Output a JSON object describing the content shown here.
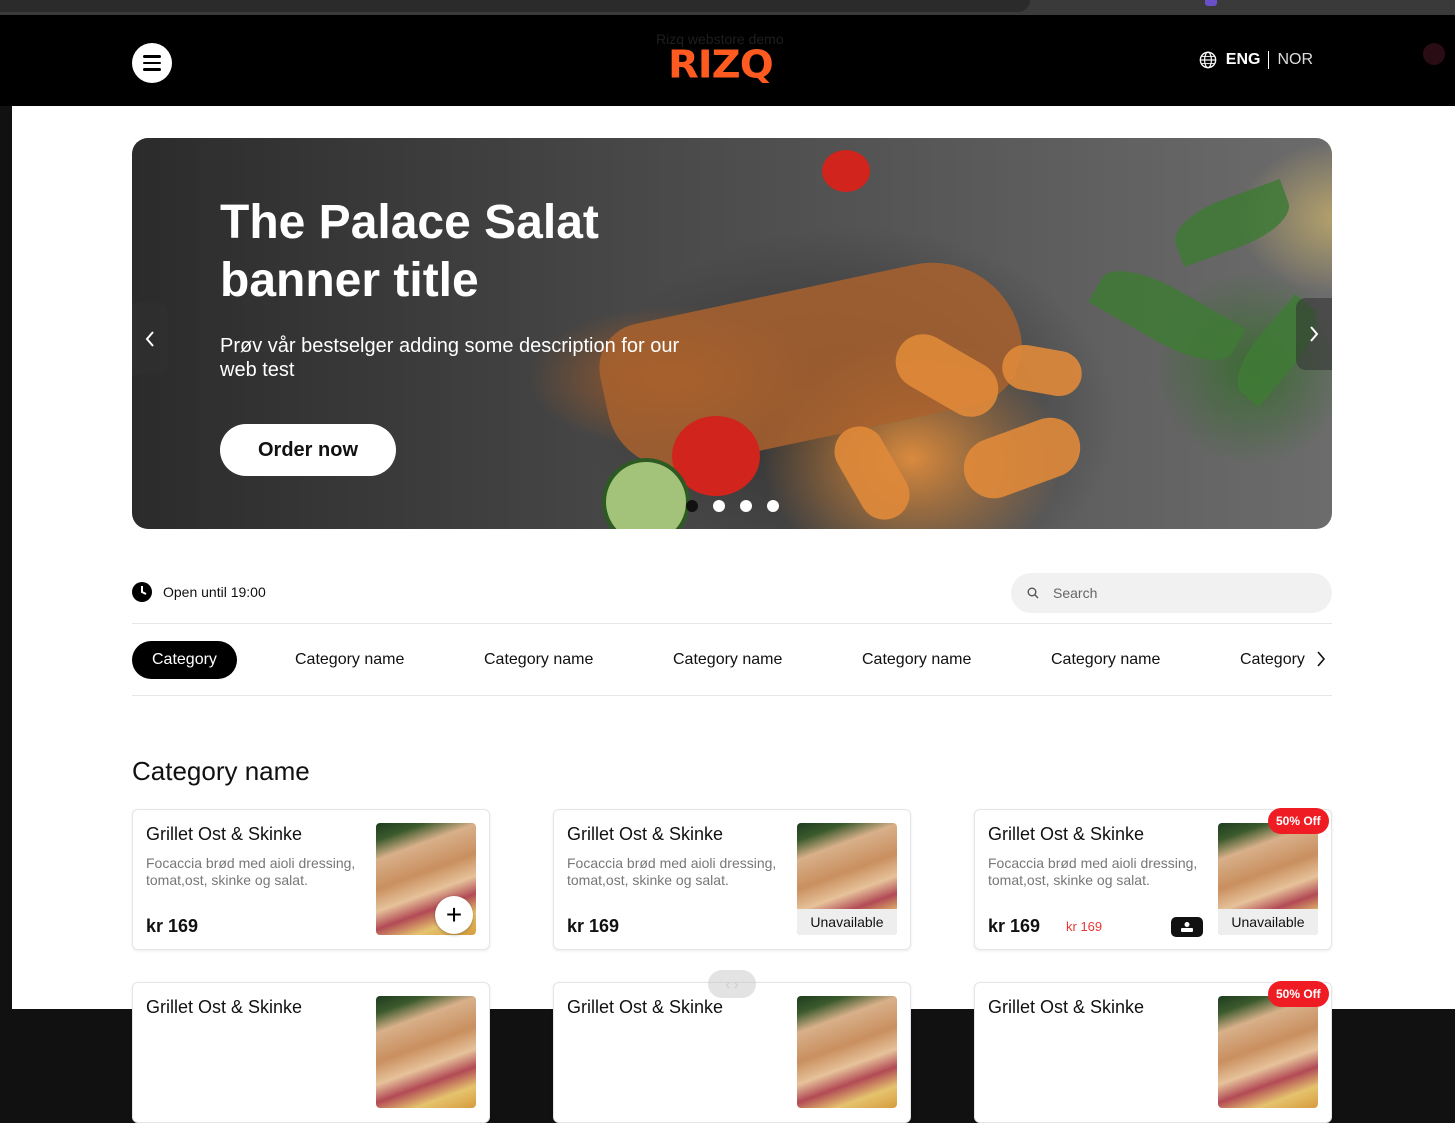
{
  "header": {
    "ghost_title": "Rizq webstore demo",
    "logo_text": "RIZQ",
    "lang_active": "ENG",
    "lang_other": "NOR"
  },
  "banner": {
    "title": "The Palace Salat banner title",
    "description": "Prøv vår bestselger adding some description for our web test",
    "order_label": "Order now",
    "slides_total": 4,
    "slide_active": 1
  },
  "status": {
    "open_text": "Open until 19:00"
  },
  "search": {
    "placeholder": "Search"
  },
  "categories": [
    "Category",
    "Category name",
    "Category name",
    "Category name",
    "Category name",
    "Category name",
    "Category"
  ],
  "section": {
    "title": "Category name"
  },
  "products": [
    {
      "name": "Grillet Ost & Skinke",
      "description": "Focaccia brød med aioli dressing, tomat,ost, skinke og salat.",
      "price": "kr 169",
      "state": "add"
    },
    {
      "name": "Grillet Ost & Skinke",
      "description": "Focaccia brød med aioli dressing, tomat,ost, skinke og salat.",
      "price": "kr 169",
      "state": "Unavailable"
    },
    {
      "name": "Grillet Ost & Skinke",
      "description": "Focaccia brød med aioli dressing, tomat,ost, skinke og salat.",
      "price": "kr 169",
      "old_price": "kr 169",
      "state": "Unavailable",
      "badge": "50% Off"
    },
    {
      "name": "Grillet Ost & Skinke"
    },
    {
      "name": "Grillet Ost & Skinke"
    },
    {
      "name": "Grillet Ost & Skinke",
      "badge": "50% Off"
    }
  ],
  "colors": {
    "brand": "#ff5a1f",
    "badge": "#ef1c24"
  }
}
